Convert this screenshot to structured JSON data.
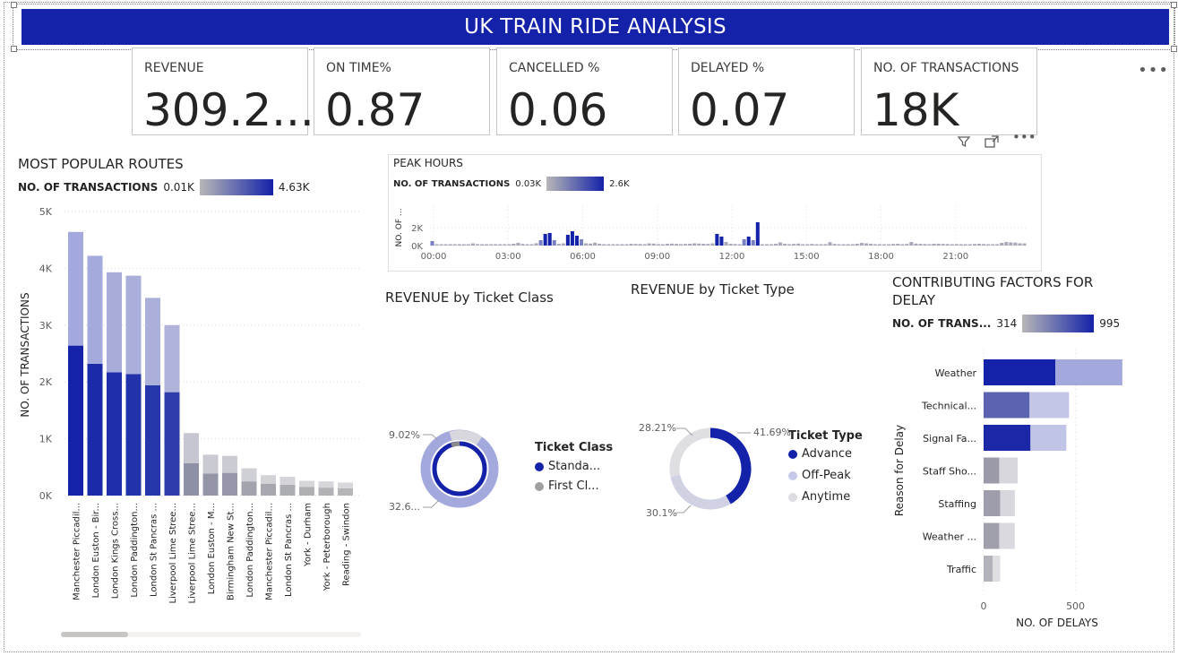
{
  "header": {
    "title": "UK TRAIN RIDE ANALYSIS"
  },
  "kpis": [
    {
      "label": "REVENUE",
      "value": "309.2..."
    },
    {
      "label": "ON TIME%",
      "value": "0.87"
    },
    {
      "label": "CANCELLED %",
      "value": "0.06"
    },
    {
      "label": "DELAYED %",
      "value": "0.07"
    },
    {
      "label": "NO. OF TRANSACTIONS",
      "value": "18K"
    }
  ],
  "toolbar": {
    "more": "•••",
    "filter_icon": "filter-icon",
    "focus_icon": "focus-mode-icon"
  },
  "popular_routes": {
    "title": "MOST POPULAR ROUTES",
    "legend_label": "NO. OF TRANSACTIONS",
    "legend_min": "0.01K",
    "legend_max": "4.63K",
    "ylabel": "NO. OF TRANSACTIONS",
    "yticks": [
      "0K",
      "1K",
      "2K",
      "3K",
      "4K",
      "5K"
    ]
  },
  "peak_hours": {
    "title": "PEAK HOURS",
    "legend_label": "NO. OF TRANSACTIONS",
    "legend_min": "0.03K",
    "legend_max": "2.6K",
    "ylabel": "NO. OF ...",
    "yticks": [
      "0K",
      "2K"
    ],
    "xticks": [
      "00:00",
      "03:00",
      "06:00",
      "09:00",
      "12:00",
      "15:00",
      "18:00",
      "21:00"
    ]
  },
  "ticket_class": {
    "title": "REVENUE by Ticket Class",
    "legend_title": "Ticket Class",
    "labels": [
      "9.02%",
      "32.6..."
    ],
    "legend": [
      "Standa...",
      "First Cl..."
    ]
  },
  "ticket_type": {
    "title": "REVENUE by Ticket Type",
    "legend_title": "Ticket Type",
    "labels": [
      "28.21%",
      "41.69%",
      "30.1%"
    ],
    "legend": [
      "Advance",
      "Off-Peak",
      "Anytime"
    ]
  },
  "delay_factors": {
    "title_line1": "CONTRIBUTING FACTORS FOR",
    "title_line2": "DELAY",
    "legend_label": "NO. OF TRANS...",
    "legend_min": "314",
    "legend_max": "995",
    "ylabel": "Reason for Delay",
    "xlabel": "NO. OF DELAYS",
    "xticks": [
      "0",
      "500"
    ]
  },
  "colors": {
    "primary": "#1322a8",
    "light": "#a3a9dd",
    "grey": "#9a9aa8",
    "lightgrey": "#d0d0d8"
  },
  "chart_data": [
    {
      "type": "bar",
      "title": "MOST POPULAR ROUTES",
      "ylabel": "NO. OF TRANSACTIONS",
      "ylim": [
        0,
        5000
      ],
      "categories": [
        "Manchester Piccadil...",
        "London Euston - Bir...",
        "London Kings Cross...",
        "London Paddington...",
        "London St Pancras ...",
        "Liverpool Lime Stree...",
        "Liverpool Lime Stree...",
        "London Euston - M...",
        "Birmingham New St...",
        "London Paddington...",
        "Manchester Piccadil...",
        "London St Pancras ...",
        "York - Durham",
        "York - Peterborough",
        "Reading - Swindon"
      ],
      "series": [
        {
          "values": [
            2640,
            2320,
            2170,
            2140,
            1940,
            1820,
            570,
            390,
            400,
            250,
            210,
            190,
            150,
            140,
            130
          ]
        },
        {
          "values": [
            2000,
            1900,
            1760,
            1730,
            1540,
            1180,
            530,
            330,
            300,
            230,
            150,
            140,
            110,
            110,
            100
          ]
        }
      ]
    },
    {
      "type": "bar",
      "title": "PEAK HOURS",
      "ylim": [
        0,
        3000
      ],
      "x_range": [
        "00:00",
        "23:45"
      ],
      "values": [
        500,
        80,
        60,
        60,
        70,
        90,
        80,
        100,
        150,
        250,
        160,
        120,
        80,
        70,
        60,
        60,
        70,
        90,
        200,
        300,
        180,
        120,
        150,
        260,
        600,
        1300,
        1400,
        600,
        200,
        250,
        1200,
        1600,
        1100,
        700,
        250,
        220,
        320,
        200,
        150,
        120,
        150,
        150,
        130,
        130,
        200,
        180,
        170,
        150,
        240,
        220,
        160,
        150,
        200,
        210,
        190,
        160,
        180,
        200,
        250,
        220,
        200,
        180,
        250,
        1300,
        1000,
        400,
        200,
        170,
        150,
        700,
        1000,
        600,
        2600,
        120,
        100,
        150,
        200,
        350,
        200,
        150,
        180,
        220,
        150,
        120,
        180,
        130,
        100,
        160,
        380,
        180,
        140,
        100,
        120,
        150,
        200,
        300,
        250,
        200,
        150,
        120,
        140,
        130,
        180,
        200,
        150,
        180,
        400,
        220,
        190,
        170,
        150,
        200,
        210,
        180,
        170,
        150,
        160,
        130,
        120,
        140,
        180,
        200,
        170,
        150,
        140,
        130,
        300,
        400,
        350,
        330,
        250,
        240
      ]
    },
    {
      "type": "pie",
      "title": "REVENUE by Ticket Class",
      "categories": [
        "Standa...",
        "First Cl..."
      ],
      "labels": [
        "9.02%",
        "32.6..."
      ]
    },
    {
      "type": "pie",
      "title": "REVENUE by Ticket Type",
      "categories": [
        "Advance",
        "Off-Peak",
        "Anytime"
      ],
      "values": [
        41.69,
        30.1,
        28.21
      ]
    },
    {
      "type": "bar",
      "title": "CONTRIBUTING FACTORS FOR DELAY",
      "xlabel": "NO. OF DELAYS",
      "ylabel": "Reason for Delay",
      "categories": [
        "Weather",
        "Technical...",
        "Signal Fa...",
        "Staff Sho...",
        "Staffing",
        "Weather ...",
        "Traffic"
      ],
      "series": [
        {
          "values": [
            390,
            250,
            255,
            85,
            90,
            85,
            50
          ]
        },
        {
          "values": [
            365,
            215,
            195,
            100,
            80,
            85,
            40
          ]
        }
      ]
    }
  ]
}
